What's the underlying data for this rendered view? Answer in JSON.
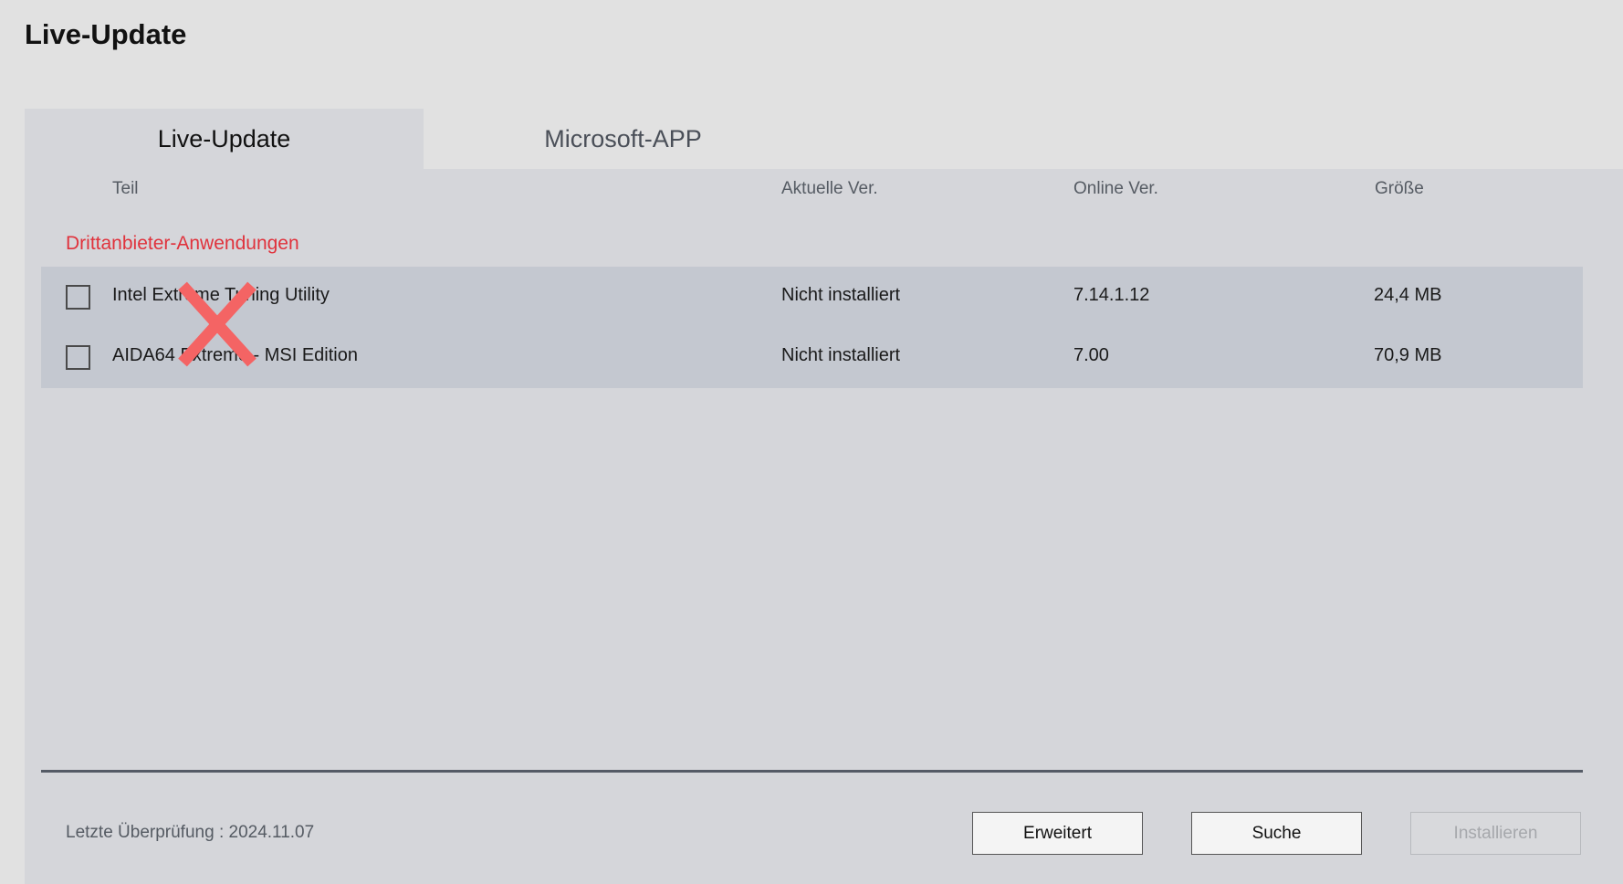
{
  "window": {
    "title": "Live-Update"
  },
  "tabs": [
    {
      "label": "Live-Update",
      "active": true
    },
    {
      "label": "Microsoft-APP",
      "active": false
    }
  ],
  "table": {
    "columns": [
      "Teil",
      "Aktuelle Ver.",
      "Online Ver.",
      "Größe"
    ],
    "category": "Drittanbieter-Anwendungen",
    "rows": [
      {
        "name": "Intel Extreme Tuning Utility",
        "current": "Nicht installiert",
        "online": "7.14.1.12",
        "size": "24,4 MB",
        "checked": false
      },
      {
        "name": "AIDA64 Extreme - MSI Edition",
        "current": "Nicht installiert",
        "online": "7.00",
        "size": "70,9 MB",
        "checked": false
      }
    ]
  },
  "footer": {
    "last_check": "Letzte Überprüfung : 2024.11.07",
    "buttons": {
      "advanced": "Erweitert",
      "search": "Suche",
      "install": "Installieren"
    }
  },
  "colors": {
    "category_red": "#e0323c",
    "overlay_x": "#f46464"
  },
  "icons": {
    "overlay": "red-x-mark-icon"
  }
}
